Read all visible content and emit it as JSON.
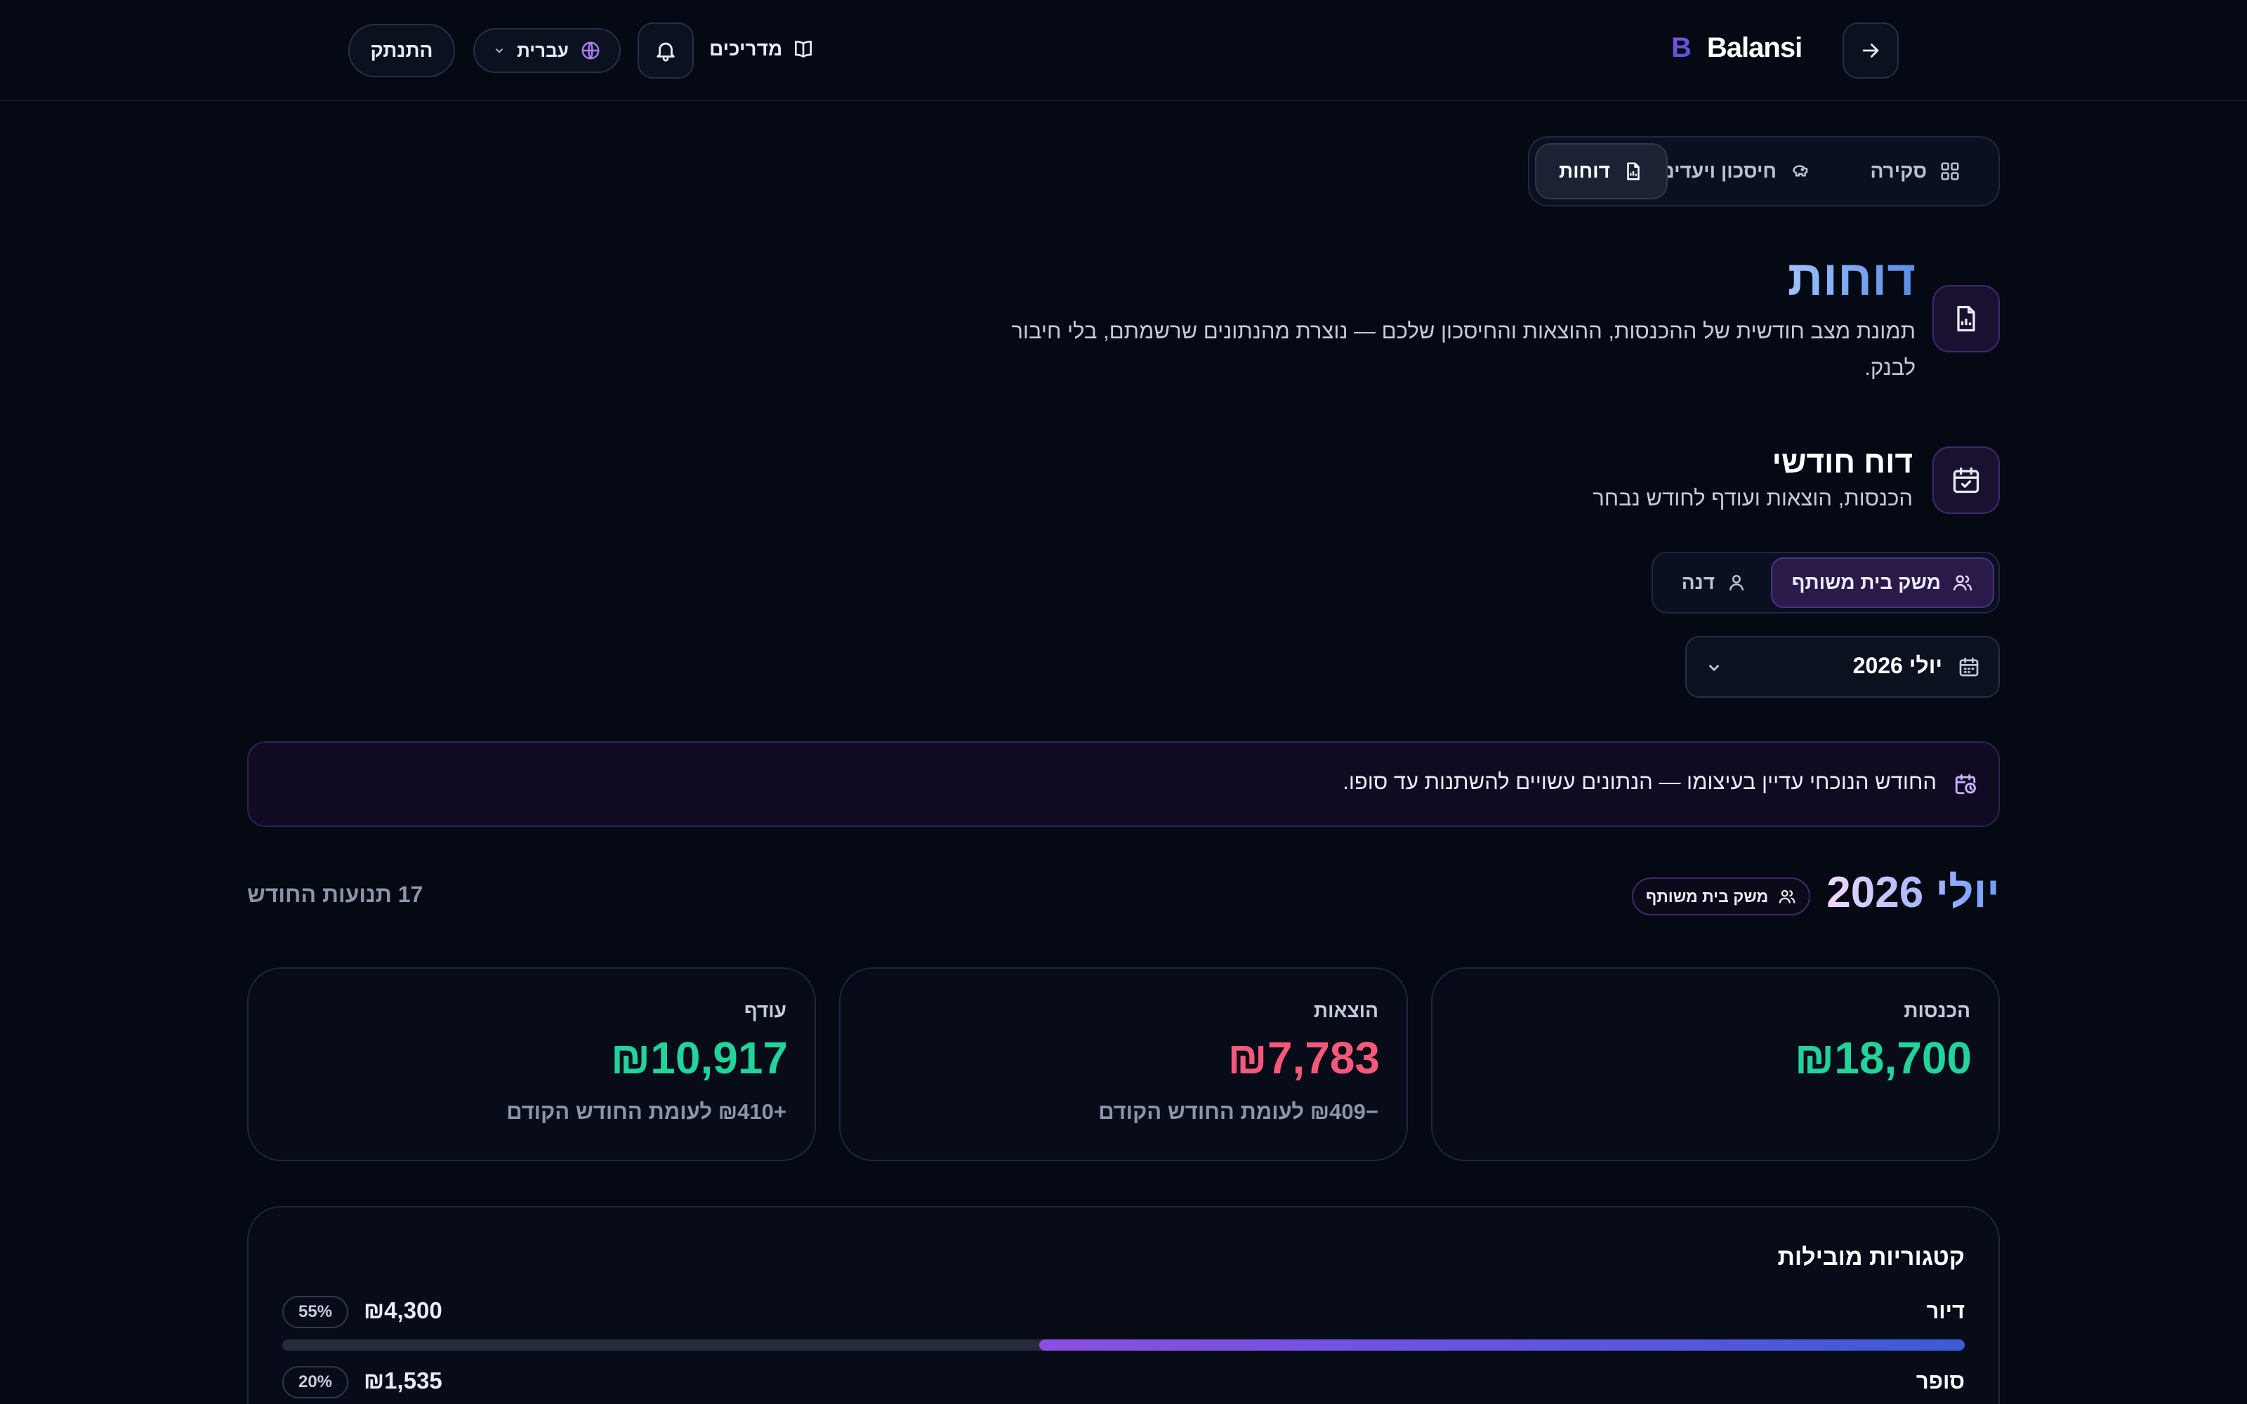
{
  "header": {
    "brand": "Balansi",
    "brand_mark": "B",
    "guides_label": "מדריכים",
    "language_label": "עברית",
    "logout_label": "התנתק"
  },
  "tabs": [
    {
      "label": "סקירה",
      "icon": "grid-icon",
      "active": false
    },
    {
      "label": "חיסכון ויעדים",
      "icon": "piggy-bank-icon",
      "active": false
    },
    {
      "label": "דוחות",
      "icon": "report-file-icon",
      "active": true
    }
  ],
  "page": {
    "title": "דוחות",
    "subtitle": "תמונת מצב חודשית של ההכנסות, ההוצאות והחיסכון שלכם — נוצרת מהנתונים שרשמתם, בלי חיבור לבנק."
  },
  "monthly_section": {
    "title": "דוח חודשי",
    "subtitle": "הכנסות, הוצאות ועודף לחודש נבחר"
  },
  "scope_toggle": [
    {
      "label": "משק בית משותף",
      "icon": "users-icon",
      "active": true
    },
    {
      "label": "דנה",
      "icon": "user-icon",
      "active": false
    }
  ],
  "month_select": {
    "value": "יולי 2026"
  },
  "notice": {
    "text": "החודש הנוכחי עדיין בעיצומו — הנתונים עשויים להשתנות עד סופו."
  },
  "report": {
    "month_title": "יולי 2026",
    "scope_badge": "משק בית משותף",
    "transactions_count": "17 תנועות החודש"
  },
  "summary_cards": [
    {
      "label": "הכנסות",
      "value": "₪18,700",
      "change": "",
      "color": "#22d39a"
    },
    {
      "label": "הוצאות",
      "value": "₪7,783",
      "change": "−₪409 לעומת החודש הקודם",
      "color": "#f5587b"
    },
    {
      "label": "עודף",
      "value": "₪10,917",
      "change": "+₪410 לעומת החודש הקודם",
      "color": "#22d39a"
    }
  ],
  "top_categories": {
    "title": "קטגוריות מובילות",
    "items": [
      {
        "name": "דיור",
        "amount": "₪4,300",
        "percent": "55%",
        "share": 0.55
      },
      {
        "name": "סופר",
        "amount": "₪1,535",
        "percent": "20%",
        "share": 0.2
      }
    ]
  },
  "colors": {
    "background": "#050914",
    "accent_purple": "#8b4fe0",
    "accent_blue": "#3d5bd6",
    "income_green": "#22d39a",
    "expense_red": "#f5587b"
  }
}
